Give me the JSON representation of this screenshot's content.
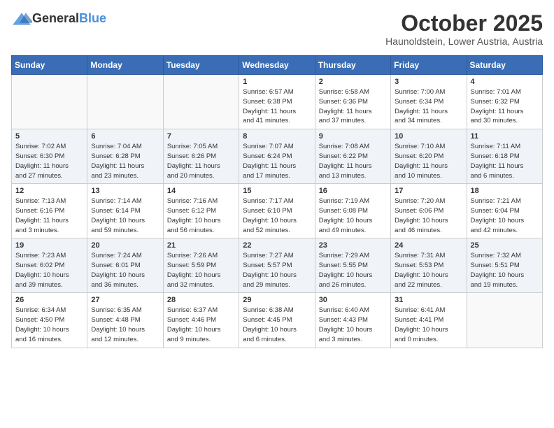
{
  "header": {
    "logo_general": "General",
    "logo_blue": "Blue",
    "month": "October 2025",
    "location": "Haunoldstein, Lower Austria, Austria"
  },
  "weekdays": [
    "Sunday",
    "Monday",
    "Tuesday",
    "Wednesday",
    "Thursday",
    "Friday",
    "Saturday"
  ],
  "weeks": [
    [
      {
        "day": "",
        "info": ""
      },
      {
        "day": "",
        "info": ""
      },
      {
        "day": "",
        "info": ""
      },
      {
        "day": "1",
        "info": "Sunrise: 6:57 AM\nSunset: 6:38 PM\nDaylight: 11 hours\nand 41 minutes."
      },
      {
        "day": "2",
        "info": "Sunrise: 6:58 AM\nSunset: 6:36 PM\nDaylight: 11 hours\nand 37 minutes."
      },
      {
        "day": "3",
        "info": "Sunrise: 7:00 AM\nSunset: 6:34 PM\nDaylight: 11 hours\nand 34 minutes."
      },
      {
        "day": "4",
        "info": "Sunrise: 7:01 AM\nSunset: 6:32 PM\nDaylight: 11 hours\nand 30 minutes."
      }
    ],
    [
      {
        "day": "5",
        "info": "Sunrise: 7:02 AM\nSunset: 6:30 PM\nDaylight: 11 hours\nand 27 minutes."
      },
      {
        "day": "6",
        "info": "Sunrise: 7:04 AM\nSunset: 6:28 PM\nDaylight: 11 hours\nand 23 minutes."
      },
      {
        "day": "7",
        "info": "Sunrise: 7:05 AM\nSunset: 6:26 PM\nDaylight: 11 hours\nand 20 minutes."
      },
      {
        "day": "8",
        "info": "Sunrise: 7:07 AM\nSunset: 6:24 PM\nDaylight: 11 hours\nand 17 minutes."
      },
      {
        "day": "9",
        "info": "Sunrise: 7:08 AM\nSunset: 6:22 PM\nDaylight: 11 hours\nand 13 minutes."
      },
      {
        "day": "10",
        "info": "Sunrise: 7:10 AM\nSunset: 6:20 PM\nDaylight: 11 hours\nand 10 minutes."
      },
      {
        "day": "11",
        "info": "Sunrise: 7:11 AM\nSunset: 6:18 PM\nDaylight: 11 hours\nand 6 minutes."
      }
    ],
    [
      {
        "day": "12",
        "info": "Sunrise: 7:13 AM\nSunset: 6:16 PM\nDaylight: 11 hours\nand 3 minutes."
      },
      {
        "day": "13",
        "info": "Sunrise: 7:14 AM\nSunset: 6:14 PM\nDaylight: 10 hours\nand 59 minutes."
      },
      {
        "day": "14",
        "info": "Sunrise: 7:16 AM\nSunset: 6:12 PM\nDaylight: 10 hours\nand 56 minutes."
      },
      {
        "day": "15",
        "info": "Sunrise: 7:17 AM\nSunset: 6:10 PM\nDaylight: 10 hours\nand 52 minutes."
      },
      {
        "day": "16",
        "info": "Sunrise: 7:19 AM\nSunset: 6:08 PM\nDaylight: 10 hours\nand 49 minutes."
      },
      {
        "day": "17",
        "info": "Sunrise: 7:20 AM\nSunset: 6:06 PM\nDaylight: 10 hours\nand 46 minutes."
      },
      {
        "day": "18",
        "info": "Sunrise: 7:21 AM\nSunset: 6:04 PM\nDaylight: 10 hours\nand 42 minutes."
      }
    ],
    [
      {
        "day": "19",
        "info": "Sunrise: 7:23 AM\nSunset: 6:02 PM\nDaylight: 10 hours\nand 39 minutes."
      },
      {
        "day": "20",
        "info": "Sunrise: 7:24 AM\nSunset: 6:01 PM\nDaylight: 10 hours\nand 36 minutes."
      },
      {
        "day": "21",
        "info": "Sunrise: 7:26 AM\nSunset: 5:59 PM\nDaylight: 10 hours\nand 32 minutes."
      },
      {
        "day": "22",
        "info": "Sunrise: 7:27 AM\nSunset: 5:57 PM\nDaylight: 10 hours\nand 29 minutes."
      },
      {
        "day": "23",
        "info": "Sunrise: 7:29 AM\nSunset: 5:55 PM\nDaylight: 10 hours\nand 26 minutes."
      },
      {
        "day": "24",
        "info": "Sunrise: 7:31 AM\nSunset: 5:53 PM\nDaylight: 10 hours\nand 22 minutes."
      },
      {
        "day": "25",
        "info": "Sunrise: 7:32 AM\nSunset: 5:51 PM\nDaylight: 10 hours\nand 19 minutes."
      }
    ],
    [
      {
        "day": "26",
        "info": "Sunrise: 6:34 AM\nSunset: 4:50 PM\nDaylight: 10 hours\nand 16 minutes."
      },
      {
        "day": "27",
        "info": "Sunrise: 6:35 AM\nSunset: 4:48 PM\nDaylight: 10 hours\nand 12 minutes."
      },
      {
        "day": "28",
        "info": "Sunrise: 6:37 AM\nSunset: 4:46 PM\nDaylight: 10 hours\nand 9 minutes."
      },
      {
        "day": "29",
        "info": "Sunrise: 6:38 AM\nSunset: 4:45 PM\nDaylight: 10 hours\nand 6 minutes."
      },
      {
        "day": "30",
        "info": "Sunrise: 6:40 AM\nSunset: 4:43 PM\nDaylight: 10 hours\nand 3 minutes."
      },
      {
        "day": "31",
        "info": "Sunrise: 6:41 AM\nSunset: 4:41 PM\nDaylight: 10 hours\nand 0 minutes."
      },
      {
        "day": "",
        "info": ""
      }
    ]
  ]
}
